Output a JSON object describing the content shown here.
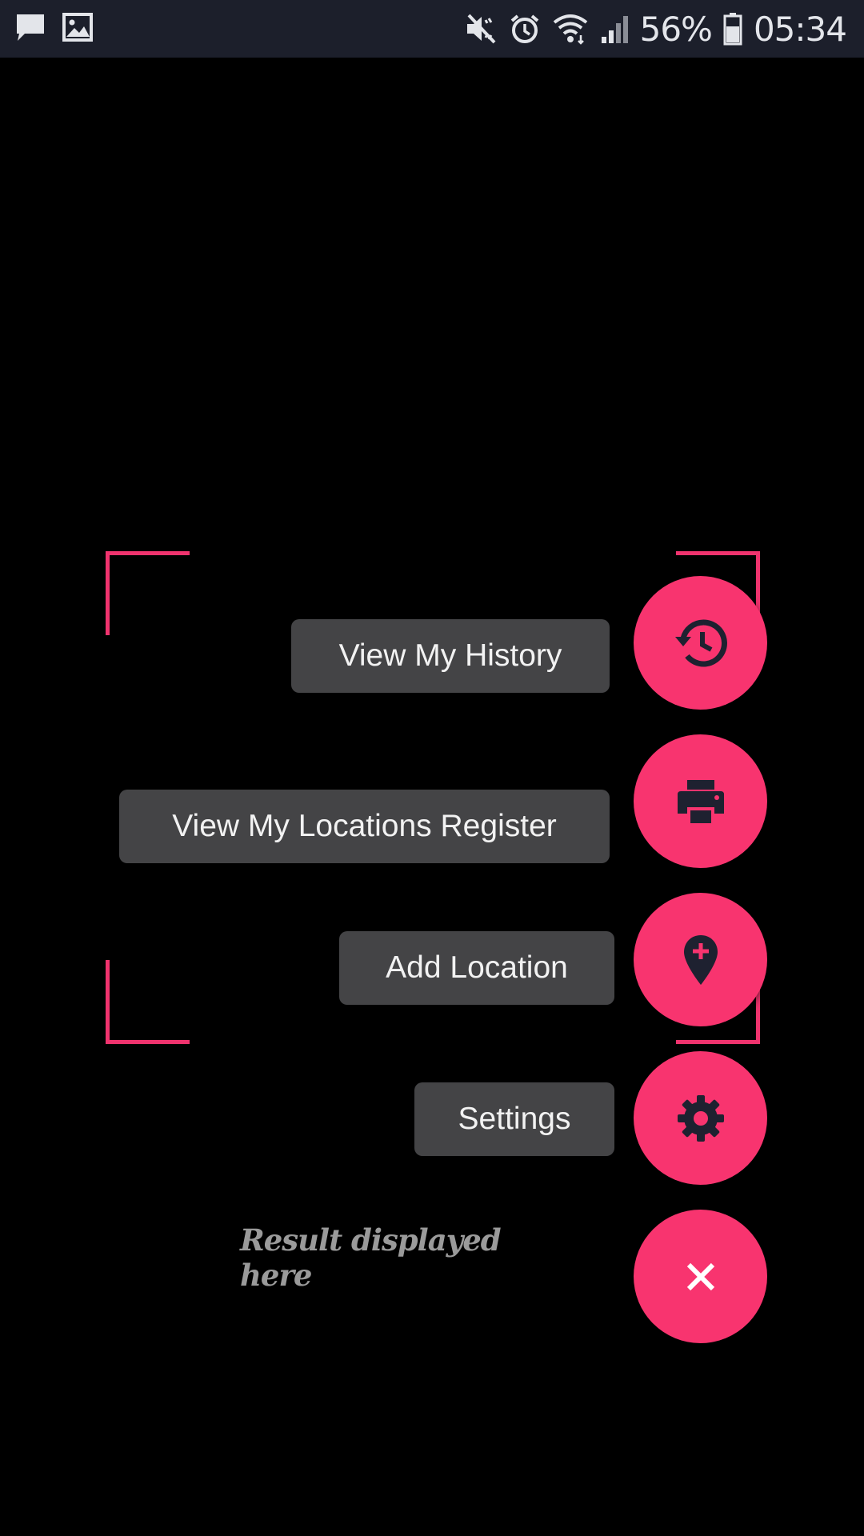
{
  "status_bar": {
    "left_icons": [
      "message-icon",
      "image-icon"
    ],
    "right_icons": [
      "mute-icon",
      "alarm-icon",
      "wifi-icon",
      "signal-icon",
      "battery-icon"
    ],
    "battery": "56%",
    "time": "05:34"
  },
  "menu": {
    "history_label": "View My History",
    "register_label": "View My Locations Register",
    "add_location_label": "Add Location",
    "settings_label": "Settings",
    "history_icon": "history-icon",
    "register_icon": "printer-icon",
    "add_location_icon": "add-location-icon",
    "settings_icon": "gear-icon",
    "close_icon": "close-icon"
  },
  "result": {
    "text": "Result displayed here"
  },
  "colors": {
    "accent": "#f8346f",
    "frame": "#f0336e",
    "label_bg": "#444446",
    "status_bg": "#1c1f2b",
    "background": "#000000",
    "icon_dark": "#1e2130"
  }
}
